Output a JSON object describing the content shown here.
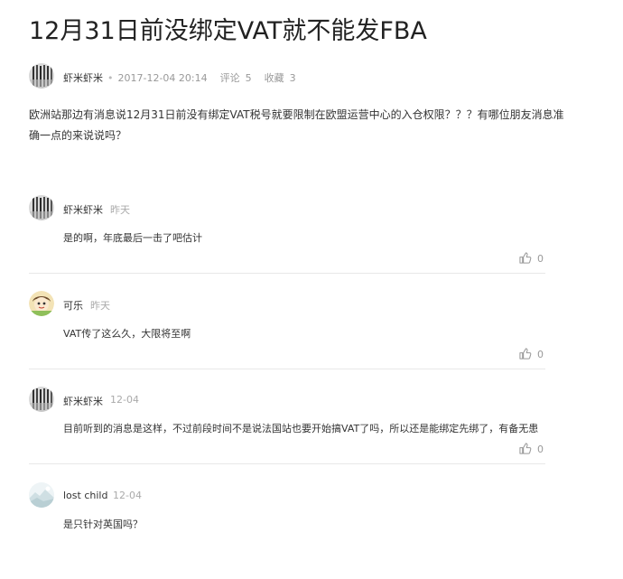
{
  "post": {
    "title": "12月31日前没绑定VAT就不能发FBA",
    "author": "虾米虾米",
    "date": "2017-12-04 20:14",
    "comments_label": "评论",
    "comments_count": "5",
    "favorites_label": "收藏",
    "favorites_count": "3",
    "body": "欧洲站那边有消息说12月31日前没有绑定VAT税号就要限制在欧盟运营中心的入仓权限？？？有哪位朋友消息准确一点的来说说吗？"
  },
  "comments": [
    {
      "author": "虾米虾米",
      "time": "昨天",
      "text": "是的啊，年底最后一击了吧估计",
      "likes": "0"
    },
    {
      "author": "可乐",
      "time": "昨天",
      "text": "VAT传了这么久，大限将至啊",
      "likes": "0"
    },
    {
      "author": "虾米虾米",
      "time": "12-04",
      "text": "目前听到的消息是这样，不过前段时间不是说法国站也要开始搞VAT了吗，所以还是能绑定先绑了，有备无患",
      "likes": "0"
    },
    {
      "author": "lost child",
      "time": "12-04",
      "text": "是只针对英国吗？"
    }
  ],
  "icons": {
    "like": "thumbs-up-icon",
    "avatar_post": "striped-avatar",
    "avatar_cola": "cartoon-avatar",
    "avatar_lost_child": "landscape-avatar"
  },
  "colors": {
    "text": "#333333",
    "muted": "#999999",
    "divider": "#e8e8e8"
  }
}
